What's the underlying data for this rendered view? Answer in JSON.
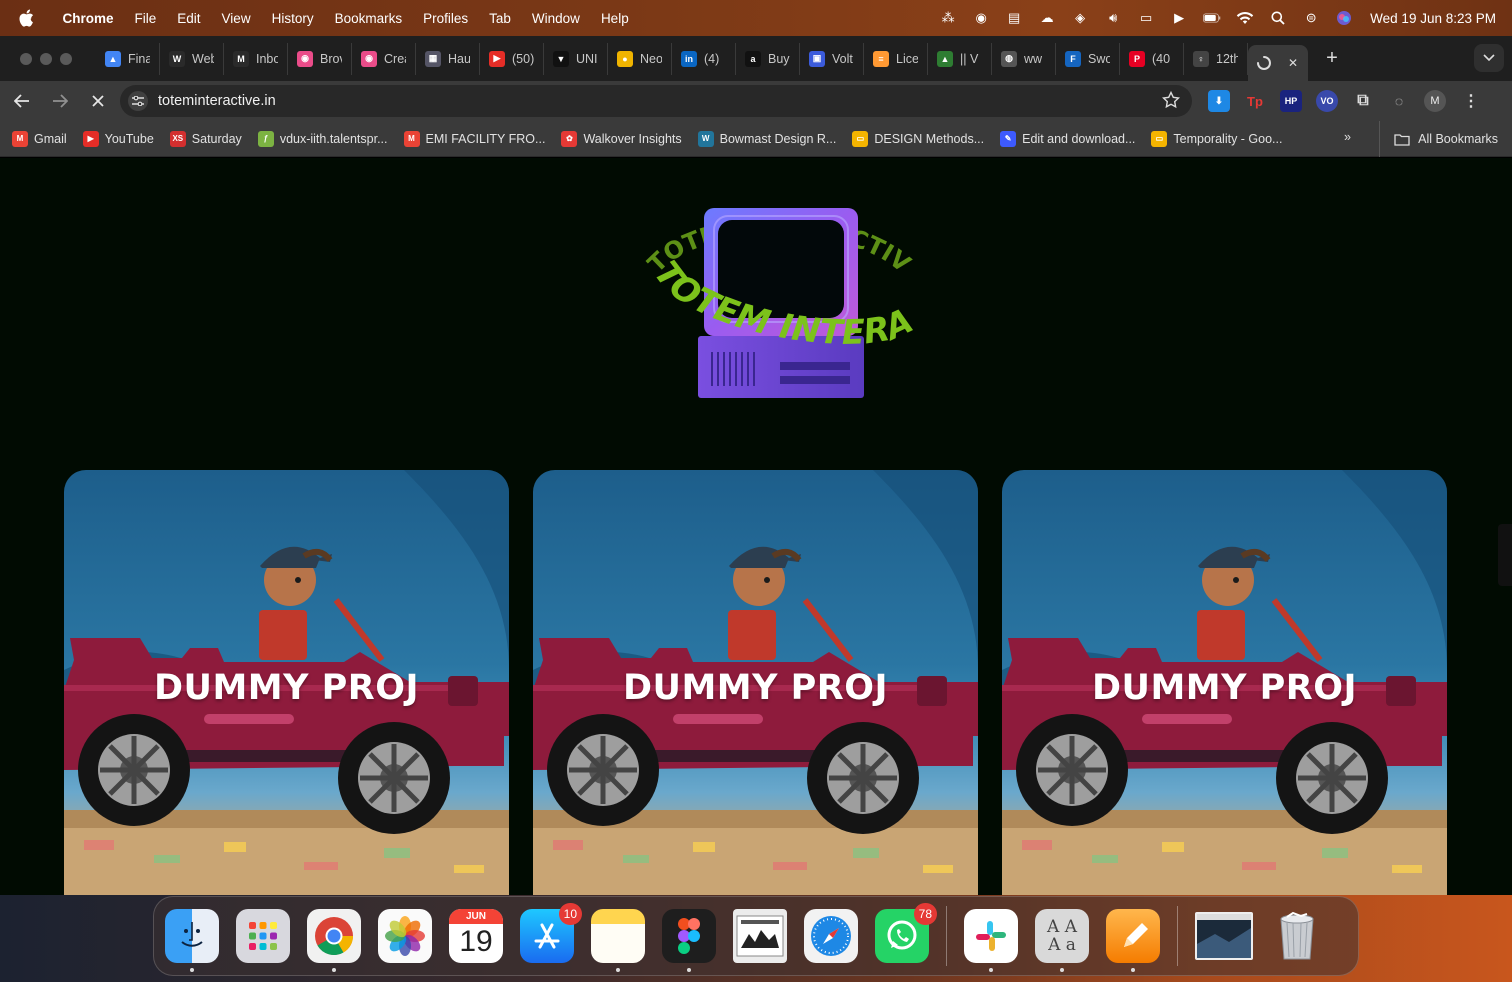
{
  "menubar": {
    "app_name": "Chrome",
    "items": [
      "File",
      "Edit",
      "View",
      "History",
      "Bookmarks",
      "Profiles",
      "Tab",
      "Window",
      "Help"
    ],
    "clock": "Wed 19 Jun  8:23 PM"
  },
  "tabs": [
    {
      "title": "Fina",
      "fav_color": "#4285f4",
      "fav_glyph": "▲"
    },
    {
      "title": "Web",
      "fav_color": "#2a2a2a",
      "fav_glyph": "W"
    },
    {
      "title": "Inbo",
      "fav_color": "#2a2a2a",
      "fav_glyph": "M"
    },
    {
      "title": "Brov",
      "fav_color": "#ea4c89",
      "fav_glyph": "◉"
    },
    {
      "title": "Crea",
      "fav_color": "#ea4c89",
      "fav_glyph": "◉"
    },
    {
      "title": "Hau",
      "fav_color": "#556",
      "fav_glyph": "▦"
    },
    {
      "title": "(50)",
      "fav_color": "#e52d27",
      "fav_glyph": "▶"
    },
    {
      "title": "UNI",
      "fav_color": "#111",
      "fav_glyph": "▼"
    },
    {
      "title": "Neo",
      "fav_color": "#f0b400",
      "fav_glyph": "●"
    },
    {
      "title": "(4)",
      "fav_color": "#0a66c2",
      "fav_glyph": "in"
    },
    {
      "title": "Buy",
      "fav_color": "#111",
      "fav_glyph": "a"
    },
    {
      "title": "Volt",
      "fav_color": "#3b5bdb",
      "fav_glyph": "▣"
    },
    {
      "title": "Lice",
      "fav_color": "#ff9933",
      "fav_glyph": "≡"
    },
    {
      "title": "|| V",
      "fav_color": "#2e7d32",
      "fav_glyph": "▲"
    },
    {
      "title": "ww",
      "fav_color": "#555",
      "fav_glyph": "◍"
    },
    {
      "title": "Swo",
      "fav_color": "#1565c0",
      "fav_glyph": "F"
    },
    {
      "title": "(40",
      "fav_color": "#e60023",
      "fav_glyph": "P"
    },
    {
      "title": "12th",
      "fav_color": "#444",
      "fav_glyph": "♀"
    }
  ],
  "active_tab": {
    "close_label": "✕"
  },
  "toolbar": {
    "url": "toteminteractive.in"
  },
  "bookmarks": [
    {
      "label": "Gmail",
      "color": "#ea4335",
      "glyph": "M"
    },
    {
      "label": "YouTube",
      "color": "#e52d27",
      "glyph": "▶"
    },
    {
      "label": "Saturday",
      "color": "#d32f2f",
      "glyph": "XS"
    },
    {
      "label": "vdux-iith.talentspr...",
      "color": "#7cb342",
      "glyph": "ƒ"
    },
    {
      "label": "EMI FACILITY FRO...",
      "color": "#ea4335",
      "glyph": "M"
    },
    {
      "label": "Walkover Insights",
      "color": "#e53935",
      "glyph": "✿"
    },
    {
      "label": "Bowmast Design R...",
      "color": "#21759b",
      "glyph": "W"
    },
    {
      "label": "DESIGN Methods...",
      "color": "#f4b400",
      "glyph": "▭"
    },
    {
      "label": "Edit and download...",
      "color": "#3d5afe",
      "glyph": "✎"
    },
    {
      "label": "Temporality - Goo...",
      "color": "#f4b400",
      "glyph": "▭"
    }
  ],
  "all_bookmarks_label": "All Bookmarks",
  "page": {
    "logo_ring_text": "TOTEM INTERACTIVE • TOTEM INTERACTIVE •",
    "cards": [
      {
        "title": "DUMMY PROJ"
      },
      {
        "title": "DUMMY PROJ"
      },
      {
        "title": "DUMMY PROJ"
      }
    ]
  },
  "dock": {
    "calendar_month": "JUN",
    "calendar_day": "19",
    "appstore_badge": "10",
    "whatsapp_badge": "78"
  },
  "colors": {
    "page_bg": "#010b02",
    "logo_ring": "#7cc21b",
    "logo_monitor": "#8a63f0"
  }
}
